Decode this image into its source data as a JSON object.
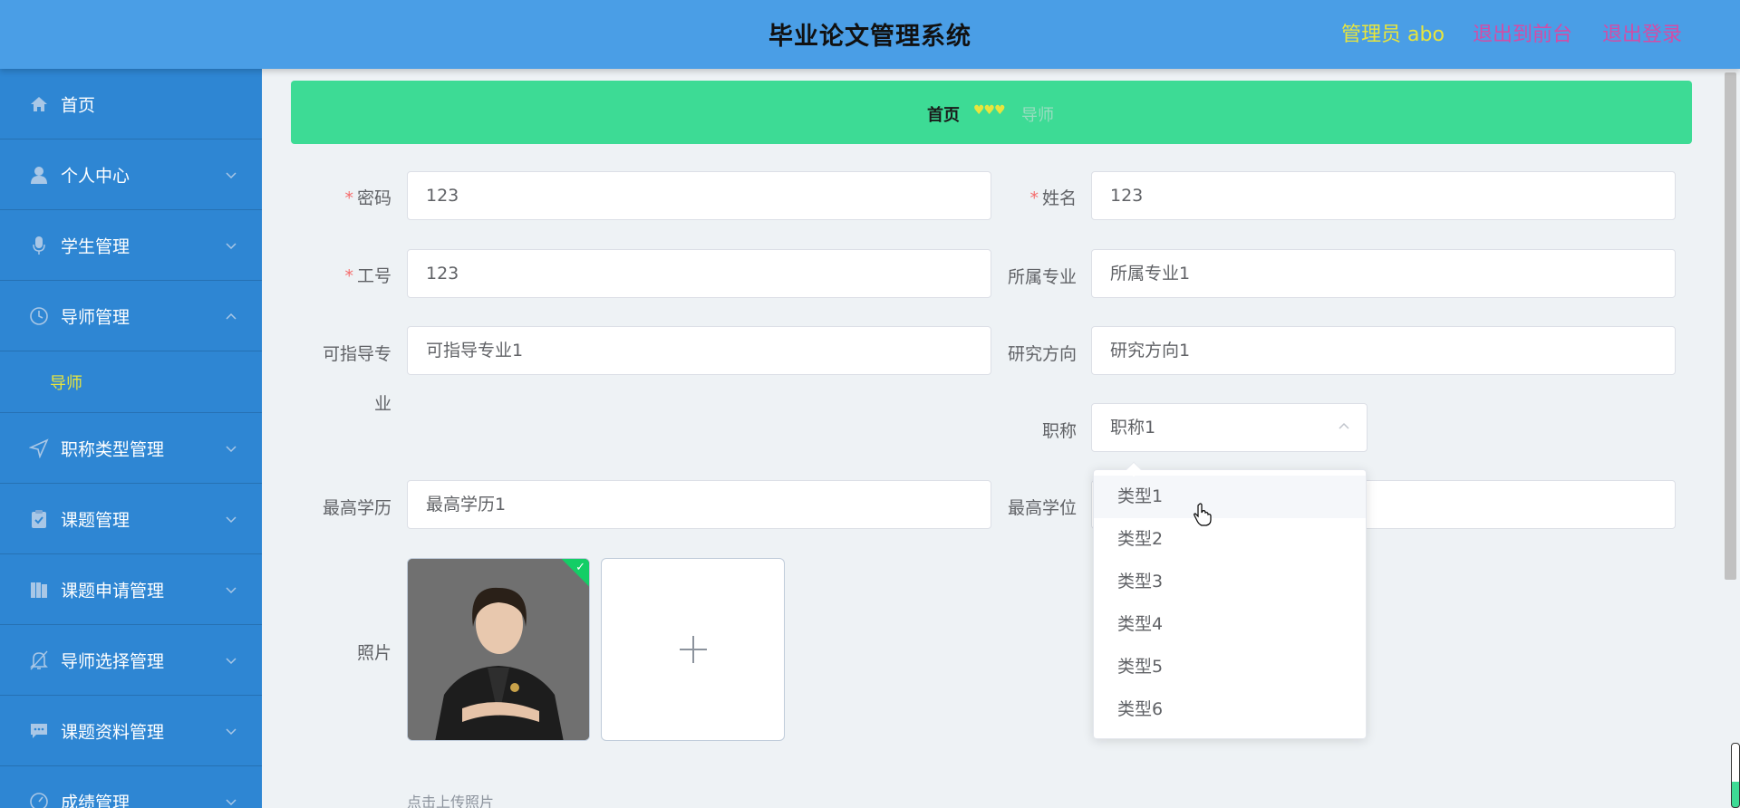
{
  "header": {
    "title": "毕业论文管理系统",
    "user": "管理员 abo",
    "to_front": "退出到前台",
    "logout": "退出登录"
  },
  "sidebar": {
    "items": [
      {
        "label": "首页",
        "icon": "home-icon"
      },
      {
        "label": "个人中心",
        "icon": "user-icon"
      },
      {
        "label": "学生管理",
        "icon": "microphone-icon"
      },
      {
        "label": "导师管理",
        "icon": "clock-icon"
      },
      {
        "label": "职称类型管理",
        "icon": "send-icon"
      },
      {
        "label": "课题管理",
        "icon": "clipboard-check-icon"
      },
      {
        "label": "课题申请管理",
        "icon": "files-icon"
      },
      {
        "label": "导师选择管理",
        "icon": "bell-icon"
      },
      {
        "label": "课题资料管理",
        "icon": "chat-icon"
      },
      {
        "label": "成绩管理",
        "icon": "gauge-icon"
      }
    ],
    "subitem": "导师"
  },
  "breadcrumb": {
    "home": "首页",
    "separator": "♥♥♥",
    "current": "导师"
  },
  "form": {
    "password": {
      "label": "密码",
      "value": "123"
    },
    "name": {
      "label": "姓名",
      "value": "123"
    },
    "job_no": {
      "label": "工号",
      "value": "123"
    },
    "major": {
      "label": "所属专业",
      "value": "所属专业1"
    },
    "guide_major": {
      "label_line1": "可指导专",
      "label_line2": "业",
      "value": "可指导专业1"
    },
    "research": {
      "label": "研究方向",
      "value": "研究方向1"
    },
    "title": {
      "label": "职称",
      "value": "职称1"
    },
    "education": {
      "label": "最高学历",
      "value": "最高学历1"
    },
    "degree": {
      "label": "最高学位"
    },
    "photo": {
      "label": "照片",
      "hint": "点击上传照片"
    },
    "required_mark": "*"
  },
  "dropdown": {
    "options": [
      "类型1",
      "类型2",
      "类型3",
      "类型4",
      "类型5",
      "类型6"
    ],
    "hovered": 0
  },
  "colors": {
    "header": "#4a9ee6",
    "sidebar": "#2e86d3",
    "breadcrumb": "#3ddb95",
    "accent_yellow": "#e8e53d",
    "link_pink": "#d24da6"
  }
}
